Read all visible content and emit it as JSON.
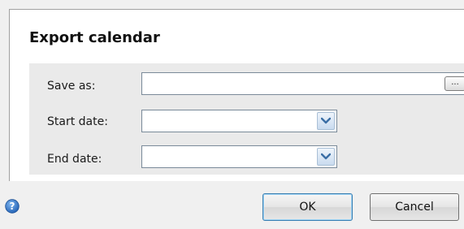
{
  "dialog": {
    "title": "Export calendar"
  },
  "form": {
    "save_as": {
      "label": "Save as:",
      "value": "",
      "browse_label": "..."
    },
    "start_date": {
      "label": "Start date:",
      "value": ""
    },
    "end_date": {
      "label": "End date:",
      "value": ""
    }
  },
  "footer": {
    "help_icon": "question-circle-icon",
    "ok_label": "OK",
    "cancel_label": "Cancel"
  },
  "colors": {
    "dialog_bg": "#f0f0f0",
    "panel_bg": "#ffffff",
    "form_band_bg": "#eaeaea",
    "dropdown_arrow": "#3a6ea5",
    "help_icon": "#2f6fc0",
    "ok_border": "#3c7fb1"
  }
}
